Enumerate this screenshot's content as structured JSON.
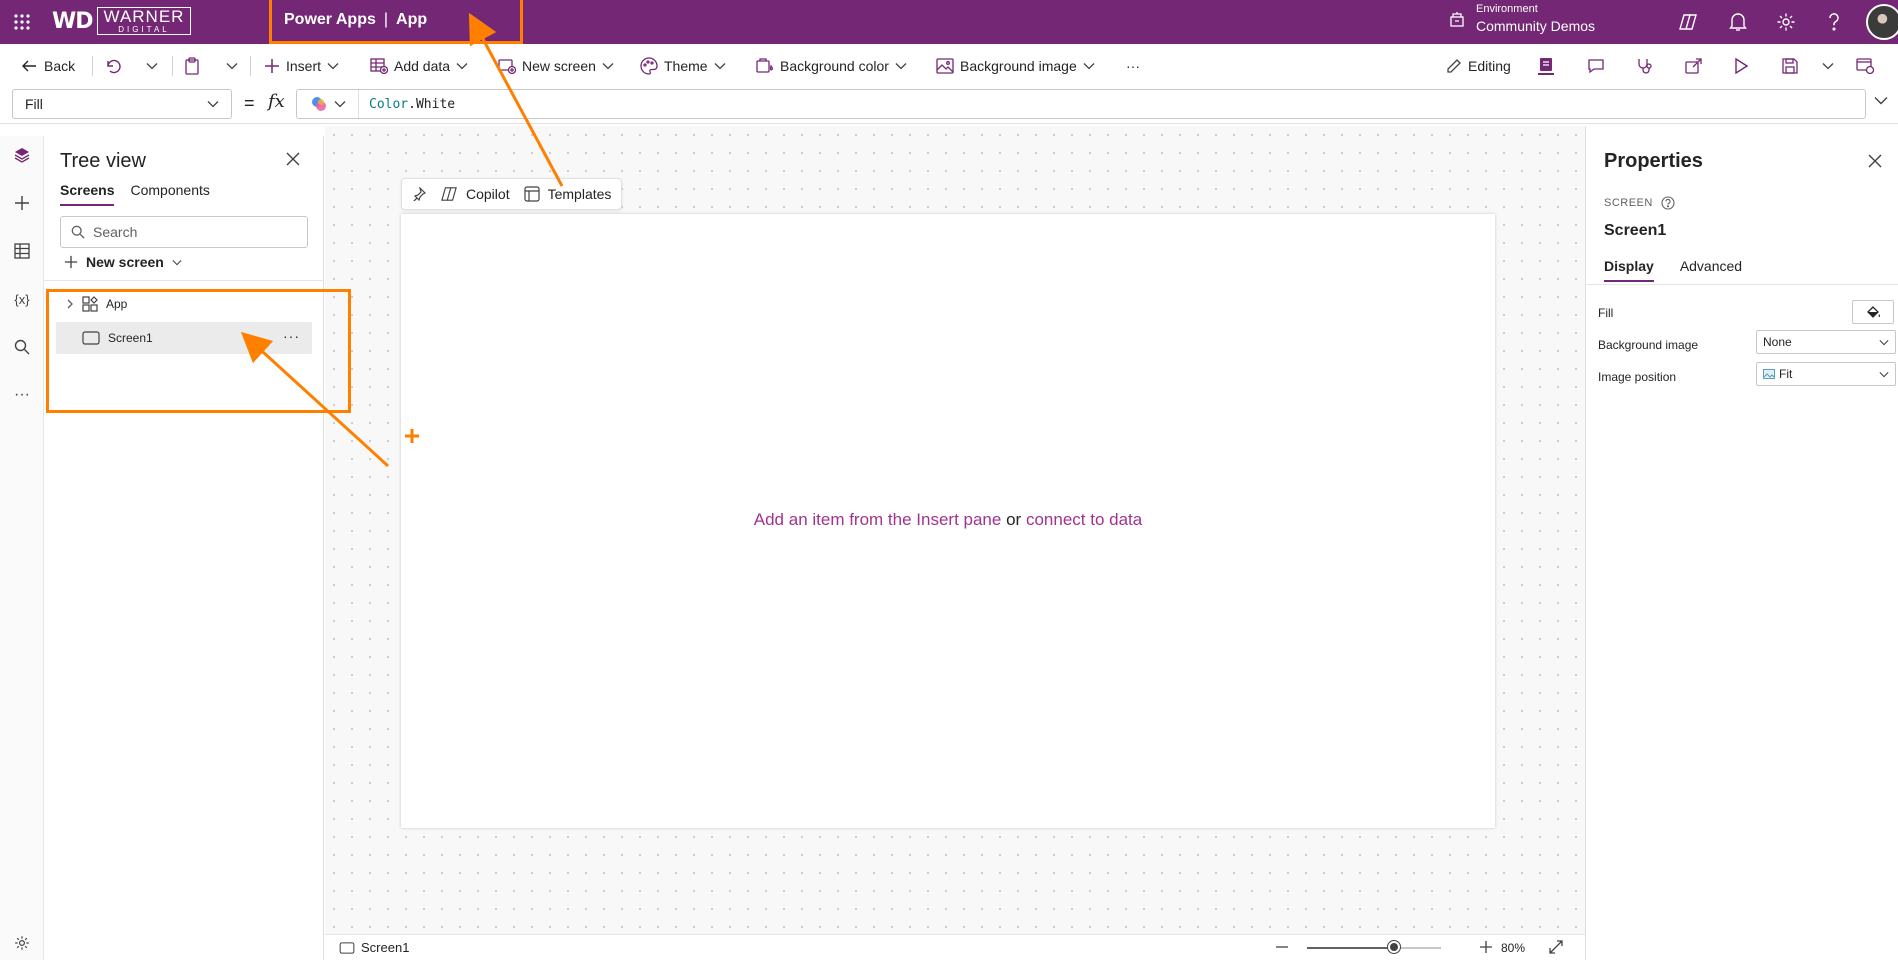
{
  "header": {
    "logo_wd": "WD",
    "logo_name": "WARNER",
    "logo_sub": "DIGITAL",
    "product": "Power Apps",
    "separator": "|",
    "app_name": "App",
    "environment_label": "Environment",
    "environment_name": "Community Demos",
    "icons": [
      "waffle-icon",
      "environment-icon",
      "copilot-icon",
      "bell-icon",
      "gear-icon",
      "help-icon"
    ]
  },
  "toolbar": {
    "back": "Back",
    "insert": "Insert",
    "add_data": "Add data",
    "new_screen": "New screen",
    "theme": "Theme",
    "background_color": "Background color",
    "background_image": "Background image",
    "more": "···",
    "editing": "Editing"
  },
  "formula_bar": {
    "property": "Fill",
    "equals": "=",
    "fx": "fx",
    "formula_ns": "Color",
    "formula_member": ".White"
  },
  "tree_view": {
    "title": "Tree view",
    "tabs": [
      {
        "label": "Screens",
        "active": true
      },
      {
        "label": "Components",
        "active": false
      }
    ],
    "search_placeholder": "Search",
    "new_screen": "New screen",
    "nodes": [
      {
        "label": "App",
        "type": "app"
      },
      {
        "label": "Screen1",
        "type": "screen",
        "selected": true,
        "more": "···"
      }
    ]
  },
  "canvas": {
    "mini_toolbar": {
      "copilot": "Copilot",
      "templates": "Templates"
    },
    "message": {
      "part1": "Add an item from the Insert pane",
      "or": "or",
      "part2": "connect to data"
    }
  },
  "status_bar": {
    "screen": "Screen1",
    "zoom": "80%",
    "zoom_fraction": 0.8
  },
  "properties": {
    "title": "Properties",
    "kind": "SCREEN",
    "name": "Screen1",
    "tabs": [
      {
        "label": "Display",
        "active": true
      },
      {
        "label": "Advanced",
        "active": false
      }
    ],
    "rows": {
      "fill_label": "Fill",
      "bg_image_label": "Background image",
      "bg_image_value": "None",
      "image_position_label": "Image position",
      "image_position_value": "Fit"
    }
  },
  "colors": {
    "brand": "#742774",
    "annotation": "#ff8000",
    "link": "#a1338f"
  }
}
